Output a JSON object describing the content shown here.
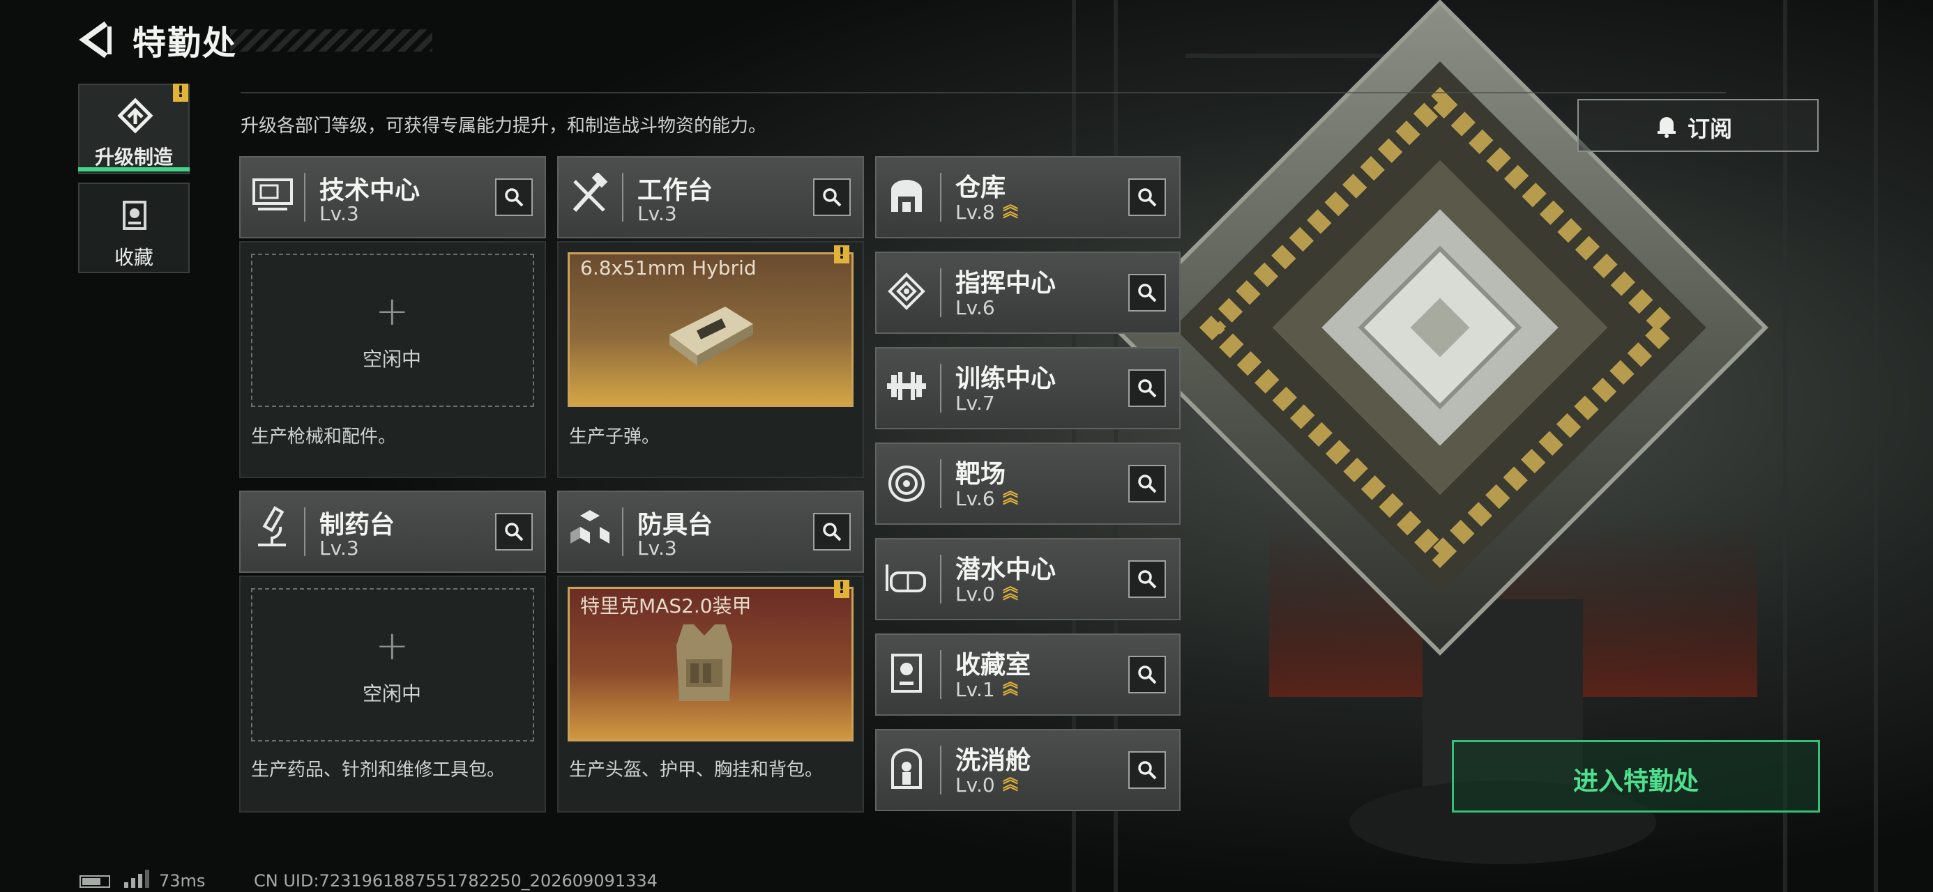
{
  "header": {
    "title": "特勤处"
  },
  "nav": {
    "items": [
      {
        "label": "升级制造",
        "icon": "upgrade-craft-icon",
        "active": true,
        "alert": "!"
      },
      {
        "label": "收藏",
        "icon": "collection-icon",
        "active": false
      }
    ]
  },
  "description": "升级各部门等级，可获得专属能力提升，和制造战斗物资的能力。",
  "subscribe": {
    "label": "订阅",
    "icon": "bell-icon"
  },
  "departments": [
    {
      "name": "技术中心",
      "level": "Lv.3",
      "icon": "tech-center-icon",
      "slot": "空闲中",
      "desc": "生产枪械和配件。"
    },
    {
      "name": "工作台",
      "level": "Lv.3",
      "icon": "workbench-icon",
      "item": "6.8x51mm Hybrid",
      "alert": "!",
      "desc": "生产子弹。"
    },
    {
      "name": "制药台",
      "level": "Lv.3",
      "icon": "pharmacy-icon",
      "slot": "空闲中",
      "desc": "生产药品、针剂和维修工具包。"
    },
    {
      "name": "防具台",
      "level": "Lv.3",
      "icon": "armor-bench-icon",
      "item": "特里克MAS2.0装甲",
      "alert": "!",
      "desc": "生产头盔、护甲、胸挂和背包。"
    }
  ],
  "facilities": [
    {
      "name": "仓库",
      "level": "Lv.8",
      "icon": "warehouse-icon",
      "upgrade": true
    },
    {
      "name": "指挥中心",
      "level": "Lv.6",
      "icon": "command-center-icon",
      "upgrade": false
    },
    {
      "name": "训练中心",
      "level": "Lv.7",
      "icon": "training-center-icon",
      "upgrade": false
    },
    {
      "name": "靶场",
      "level": "Lv.6",
      "icon": "shooting-range-icon",
      "upgrade": true
    },
    {
      "name": "潜水中心",
      "level": "Lv.0",
      "icon": "diving-center-icon",
      "upgrade": true
    },
    {
      "name": "收藏室",
      "level": "Lv.1",
      "icon": "collection-room-icon",
      "upgrade": true
    },
    {
      "name": "洗消舱",
      "level": "Lv.0",
      "icon": "decontamination-icon",
      "upgrade": true
    }
  ],
  "enter_button": {
    "label": "进入特勤处"
  },
  "footer": {
    "ping": "73ms",
    "uid": "CN UID:7231961887551782250_202609091334"
  },
  "colors": {
    "accent_green": "#3fd68a",
    "alert_yellow": "#e2b339",
    "panel": "#3a3d3c"
  }
}
